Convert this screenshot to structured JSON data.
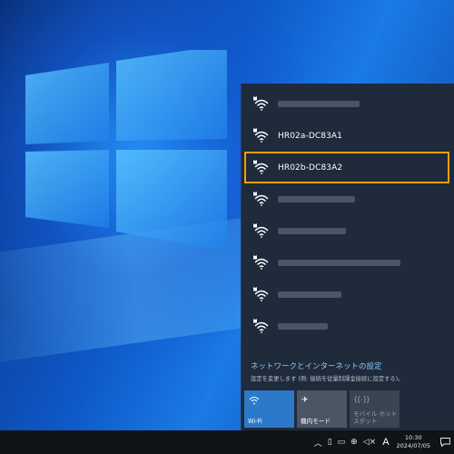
{
  "networks": [
    {
      "name": "",
      "blur": 90,
      "secured": true
    },
    {
      "name": "HR02a-DC83A1",
      "blur": 0,
      "secured": true
    },
    {
      "name": "HR02b-DC83A2",
      "blur": 0,
      "secured": true,
      "selected": true
    },
    {
      "name": "",
      "blur": 85,
      "secured": true
    },
    {
      "name": "",
      "blur": 75,
      "secured": true
    },
    {
      "name": "",
      "blur": 135,
      "secured": true
    },
    {
      "name": "",
      "blur": 70,
      "secured": true
    },
    {
      "name": "",
      "blur": 55,
      "secured": true
    }
  ],
  "settings": {
    "link": "ネットワークとインターネットの設定",
    "desc": "設定を変更します (例: 接続を従量制課金接続に設定する)。"
  },
  "tiles": [
    {
      "label": "Wi-Fi",
      "icon": "wifi-icon",
      "state": "on"
    },
    {
      "label": "機内モード",
      "icon": "airplane-icon",
      "state": "off"
    },
    {
      "label": "モバイル ホットスポット",
      "icon": "hotspot-icon",
      "state": "disabled"
    }
  ],
  "taskbar": {
    "ime": "A",
    "time": "10:30",
    "date": "2024/07/05"
  },
  "colors": {
    "selection": "#f59f00",
    "flyout_bg": "#1f2a3a",
    "link": "#8fc7ff",
    "tile_on": "#2c79c9"
  }
}
